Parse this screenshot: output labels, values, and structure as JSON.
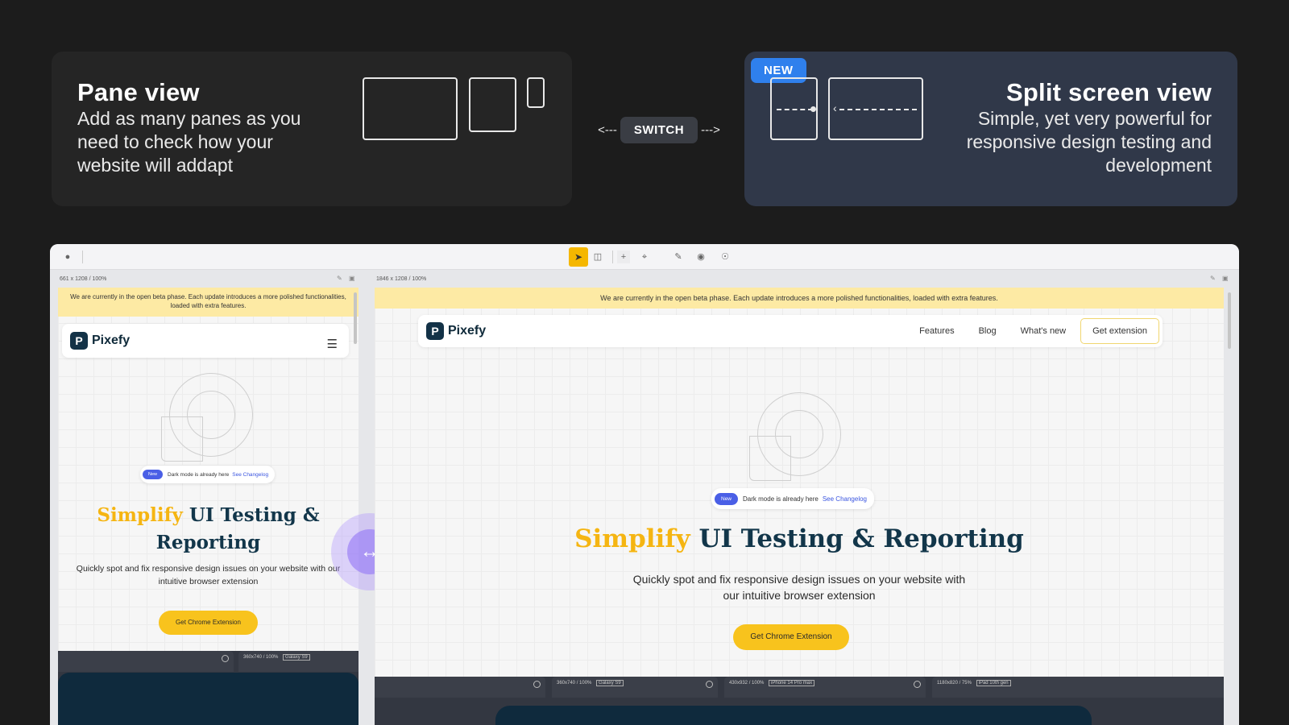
{
  "pane_card": {
    "title": "Pane view",
    "description": "Add as many panes as you need to check how your website will addapt"
  },
  "switch": {
    "label": "SWITCH",
    "left": "<---",
    "right": "--->"
  },
  "split_card": {
    "badge": "NEW",
    "title": "Split screen view",
    "description": "Simple, yet very powerful for responsive design testing and development"
  },
  "left_pane": {
    "meta": "661 x 1208  /  100%",
    "beta": "We are currently in the open beta phase. Each update introduces a more polished functionalities, loaded with extra features.",
    "logo": "Pixefy",
    "news_tag": "New",
    "news_text": "Dark mode is already here",
    "news_link": "See Changelog",
    "hero_yellow": "Simplify",
    "hero_rest": " UI Testing & Reporting",
    "subtitle": "Quickly spot and fix responsive design issues on your website with our intuitive browser extension",
    "cta": "Get Chrome Extension",
    "device_tab": "360x740 / 100%",
    "device_name": "Galaxy S9"
  },
  "right_pane": {
    "meta": "1846 x 1208  /  100%",
    "beta": "We are currently in the open beta phase. Each update introduces a more polished functionalities, loaded with extra features.",
    "logo": "Pixefy",
    "nav": [
      "Features",
      "Blog",
      "What's new"
    ],
    "nav_cta": "Get extension",
    "news_tag": "New",
    "news_text": "Dark mode is already here",
    "news_link": "See Changelog",
    "hero_yellow": "Simplify",
    "hero_rest": " UI Testing & Reporting",
    "subtitle_1": "Quickly spot and fix responsive design issues on your website with",
    "subtitle_2": "our intuitive browser extension",
    "cta": "Get Chrome Extension",
    "device_tabs": [
      {
        "size": "360x740 / 100%",
        "name": "Galaxy S9"
      },
      {
        "size": "430x932 / 100%",
        "name": "iPhone 14 Pro max"
      },
      {
        "size": "1180x820 / 75%",
        "name": "iPad 10th gen"
      }
    ]
  },
  "icons": {
    "handle": "resize-horizontal-icon",
    "hamburger": "menu-icon"
  },
  "colors": {
    "accent_yellow": "#F5B512",
    "badge_blue": "#2F80ED",
    "brand_navy": "#12364A"
  }
}
